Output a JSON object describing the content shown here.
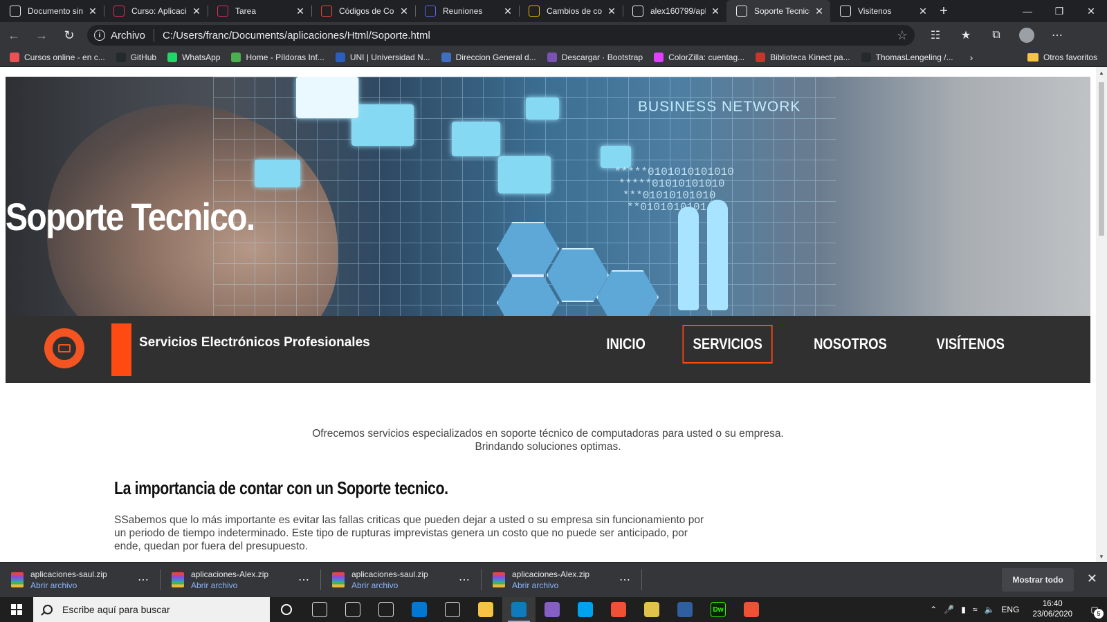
{
  "browser": {
    "tabs": [
      {
        "title": "Documento sin t",
        "icon": "document-icon",
        "color": "#e8eaed"
      },
      {
        "title": "Curso: Aplicacion",
        "icon": "mooc-icon",
        "color": "#e02e5a"
      },
      {
        "title": "Tarea",
        "icon": "mooc-icon",
        "color": "#e02e5a"
      },
      {
        "title": "Códigos de Colo",
        "icon": "color-codes-icon",
        "color": "#e94b2e"
      },
      {
        "title": "Reuniones",
        "icon": "discord-icon",
        "color": "#5865f2"
      },
      {
        "title": "Cambios de colo",
        "icon": "sheet-icon",
        "color": "#f4b400"
      },
      {
        "title": "alex160799/apli",
        "icon": "github-icon",
        "color": "#e8eaed"
      },
      {
        "title": "Soporte Tecnico",
        "icon": "document-icon",
        "color": "#e8eaed"
      },
      {
        "title": "Visitenos",
        "icon": "document-icon",
        "color": "#e8eaed"
      }
    ],
    "active_tab_index": 7,
    "address": {
      "scheme_label": "Archivo",
      "url": "C:/Users/franc/Documents/aplicaciones/Html/Soporte.html"
    },
    "bookmarks": [
      {
        "label": "Cursos online - en c...",
        "icon": "udemy-icon",
        "color": "#ec5252"
      },
      {
        "label": "GitHub",
        "icon": "github-icon",
        "color": "#24292e"
      },
      {
        "label": "WhatsApp",
        "icon": "whatsapp-icon",
        "color": "#25d366"
      },
      {
        "label": "Home - Píldoras Inf...",
        "icon": "pildoras-icon",
        "color": "#4caf50"
      },
      {
        "label": "UNI | Universidad N...",
        "icon": "uni-icon",
        "color": "#2b5fbf"
      },
      {
        "label": "Direccion General d...",
        "icon": "dg-icon",
        "color": "#3f6fc0"
      },
      {
        "label": "Descargar · Bootstrap",
        "icon": "bootstrap-icon",
        "color": "#7952b3"
      },
      {
        "label": "ColorZilla: cuentag...",
        "icon": "colorzilla-icon",
        "color": "#e040fb"
      },
      {
        "label": "Biblioteca Kinect pa...",
        "icon": "kinect-icon",
        "color": "#c0392b"
      },
      {
        "label": "ThomasLengeling /...",
        "icon": "github-icon",
        "color": "#24292e"
      }
    ],
    "other_bookmarks": "Otros favoritos"
  },
  "page": {
    "hero": {
      "title": "Soporte Tecnico.",
      "overlay_text": "BUSINESS NETWORK",
      "binary_lines": [
        "*****0101010101010",
        "*****01010101010",
        "***01010101010",
        "**0101010101"
      ]
    },
    "navbar": {
      "brand": "Servicios Electrónicos Profesionales",
      "menu": [
        {
          "label": "INICIO",
          "active": false
        },
        {
          "label": "SERVICIOS",
          "active": true
        },
        {
          "label": "NOSOTROS",
          "active": false
        },
        {
          "label": "VISÍTENOS",
          "active": false
        }
      ],
      "accent_color": "#ff4a11"
    },
    "intro": {
      "line1": "Ofrecemos servicios especializados en soporte técnico de computadoras para usted o su empresa.",
      "line2": "Brindando soluciones optimas."
    },
    "section": {
      "title": "La importancia de contar con un Soporte tecnico.",
      "paragraph": "SSabemos que lo más importante es evitar las fallas criticas que pueden dejar a usted o su empresa sin funcionamiento por un periodo de tiempo indeterminado. Este tipo de rupturas imprevistas genera un costo que no puede ser anticipado, por ende, quedan por fuera del presupuesto."
    }
  },
  "downloads": {
    "items": [
      {
        "name": "aplicaciones-saul.zip",
        "action": "Abrir archivo"
      },
      {
        "name": "aplicaciones-Alex.zip",
        "action": "Abrir archivo"
      },
      {
        "name": "aplicaciones-saul.zip",
        "action": "Abrir archivo"
      },
      {
        "name": "aplicaciones-Alex.zip",
        "action": "Abrir archivo"
      }
    ],
    "show_all": "Mostrar todo"
  },
  "taskbar": {
    "search_placeholder": "Escribe aquí para buscar",
    "apps": [
      {
        "name": "task-view-icon",
        "label": "",
        "color": "#1f1f1f"
      },
      {
        "name": "store-icon",
        "label": "",
        "color": "#1f1f1f"
      },
      {
        "name": "chrome-icon",
        "label": "",
        "color": "#1f1f1f"
      },
      {
        "name": "mail-icon",
        "label": "",
        "color": "#0078d4"
      },
      {
        "name": "settings-icon",
        "label": "",
        "color": "#1f1f1f"
      },
      {
        "name": "file-explorer-icon",
        "label": "",
        "color": "#f6c344"
      },
      {
        "name": "edge-icon",
        "label": "",
        "color": "#0f7bbd"
      },
      {
        "name": "visual-studio-icon",
        "label": "",
        "color": "#865fc5"
      },
      {
        "name": "azure-data-icon",
        "label": "",
        "color": "#00a2ed"
      },
      {
        "name": "git-icon",
        "label": "",
        "color": "#f05033"
      },
      {
        "name": "folder-tool-icon",
        "label": "",
        "color": "#e0c34a"
      },
      {
        "name": "network-icon",
        "label": "",
        "color": "#2f5f9e"
      },
      {
        "name": "dreamweaver-icon",
        "label": "Dw",
        "color": "#35fa00"
      },
      {
        "name": "git-kraken-icon",
        "label": "",
        "color": "#f05033"
      }
    ],
    "language": "ENG",
    "time": "16:40",
    "date": "23/06/2020",
    "notifications": "5"
  }
}
